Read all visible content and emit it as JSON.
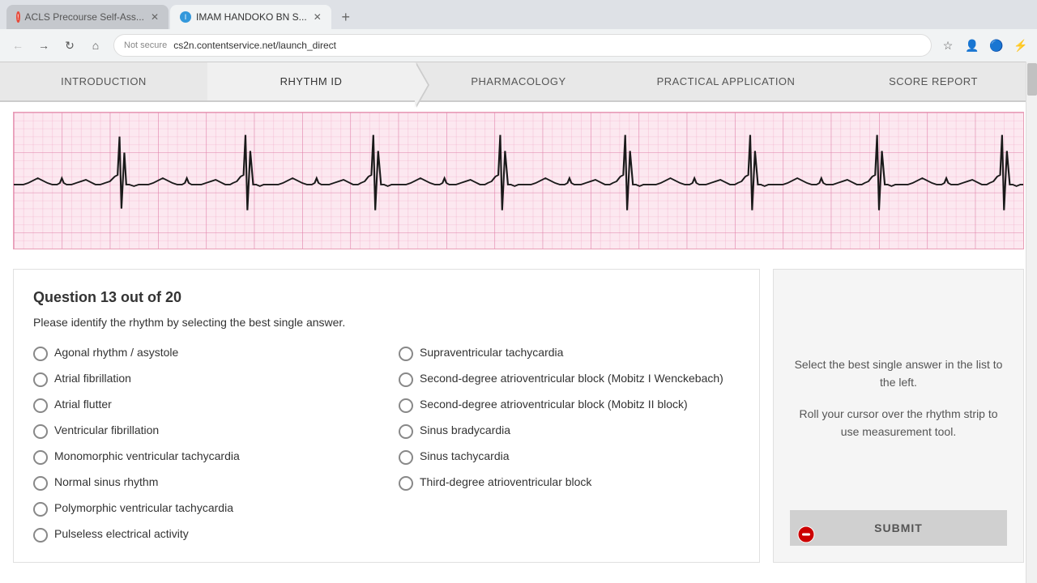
{
  "browser": {
    "tabs": [
      {
        "id": "acls",
        "label": "ACLS Precourse Self-Ass...",
        "favicon_type": "acls",
        "active": false
      },
      {
        "id": "imam",
        "label": "IMAM HANDOKO BN S...",
        "favicon_type": "imam",
        "active": true
      }
    ],
    "url": "cs2n.contentservice.net/launch_direct",
    "protocol": "Not secure"
  },
  "nav": {
    "items": [
      {
        "id": "introduction",
        "label": "INTRODUCTION",
        "active": false
      },
      {
        "id": "rhythm-id",
        "label": "RHYTHM ID",
        "active": true
      },
      {
        "id": "pharmacology",
        "label": "PHARMACOLOGY",
        "active": false
      },
      {
        "id": "practical-application",
        "label": "PRACTICAL APPLICATION",
        "active": false
      },
      {
        "id": "score-report",
        "label": "SCORE REPORT",
        "active": false
      }
    ]
  },
  "question": {
    "number": "Question 13 out of 20",
    "text": "Please identify the rhythm by selecting the best single answer.",
    "answers": [
      {
        "id": "agonal",
        "label": "Agonal rhythm / asystole",
        "column": 1
      },
      {
        "id": "atrial-fib",
        "label": "Atrial fibrillation",
        "column": 1
      },
      {
        "id": "atrial-flutter",
        "label": "Atrial flutter",
        "column": 1
      },
      {
        "id": "vent-fib",
        "label": "Ventricular fibrillation",
        "column": 1
      },
      {
        "id": "mono-vent-tachy",
        "label": "Monomorphic ventricular tachycardia",
        "column": 1
      },
      {
        "id": "normal-sinus",
        "label": "Normal sinus rhythm",
        "column": 1
      },
      {
        "id": "poly-vent-tachy",
        "label": "Polymorphic ventricular tachycardia",
        "column": 1
      },
      {
        "id": "pulseless",
        "label": "Pulseless electrical activity",
        "column": 1
      },
      {
        "id": "supra-tachy",
        "label": "Supraventricular tachycardia",
        "column": 2
      },
      {
        "id": "second-deg-mobitz1",
        "label": "Second-degree atrioventricular block (Mobitz I Wenckebach)",
        "column": 2
      },
      {
        "id": "second-deg-mobitz2",
        "label": "Second-degree atrioventricular block (Mobitz II block)",
        "column": 2
      },
      {
        "id": "sinus-brady",
        "label": "Sinus bradycardia",
        "column": 2
      },
      {
        "id": "sinus-tachy",
        "label": "Sinus tachycardia",
        "column": 2
      },
      {
        "id": "third-deg",
        "label": "Third-degree atrioventricular block",
        "column": 2
      }
    ]
  },
  "sidebar": {
    "instruction1": "Select the best single answer in the list to the left.",
    "instruction2": "Roll your cursor over the rhythm strip to use measurement tool."
  },
  "submit": {
    "label": "SUBMIT"
  }
}
